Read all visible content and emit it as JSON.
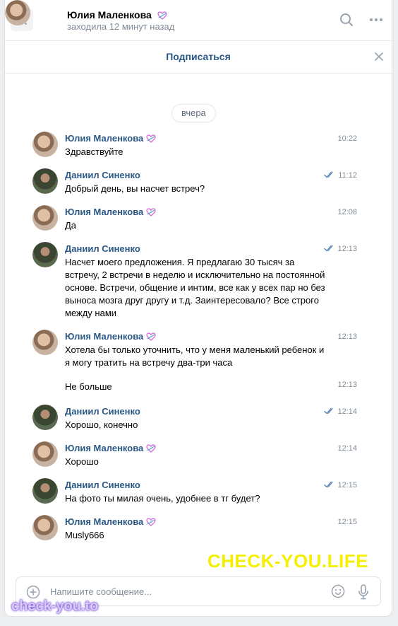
{
  "header": {
    "name": "Юлия Маленкова",
    "status": "заходила 12 минут назад"
  },
  "subscribe": {
    "label": "Подписаться"
  },
  "date_divider": "вчера",
  "messages": [
    {
      "author": "Юлия Маленкова",
      "time": "10:22",
      "text": "Здравствуйте",
      "read": false
    },
    {
      "author": "Даниил Синенко",
      "time": "11:12",
      "text": "Добрый день, вы насчет встреч?",
      "read": true
    },
    {
      "author": "Юлия Маленкова",
      "time": "12:08",
      "text": "Да",
      "read": false
    },
    {
      "author": "Даниил Синенко",
      "time": "12:13",
      "text": "Насчет моего предложения. Я предлагаю 30 тысяч за встречу, 2 встречи в неделю и исключительно на постоянной основе. Встречи, общение и интим, все как у всех пар но без выноса мозга друг другу и т.д. Заинтересовало? Все строго между нами",
      "read": true
    },
    {
      "author": "Юлия Маленкова",
      "time": "12:13",
      "text": "Хотела бы только уточнить, что у меня маленький ребенок и я могу тратить на встречу два-три часа",
      "read": false
    },
    {
      "author": "",
      "time": "12:13",
      "text": "Не больше",
      "read": false
    },
    {
      "author": "Даниил Синенко",
      "time": "12:14",
      "text": "Хорошо, конечно",
      "read": true
    },
    {
      "author": "Юлия Маленкова",
      "time": "12:14",
      "text": "Хорошо",
      "read": false
    },
    {
      "author": "Даниил Синенко",
      "time": "12:15",
      "text": "На фото ты милая очень, удобнее в тг будет?",
      "read": true
    },
    {
      "author": "Юлия Маленкова",
      "time": "12:15",
      "text": "Musly666",
      "read": false
    }
  ],
  "composer": {
    "placeholder": "Напишите сообщение..."
  },
  "watermarks": {
    "big": "CHECK-YOU.LIFE",
    "small": "check-you.to"
  },
  "colors": {
    "link": "#2a5885",
    "muted": "#818c99",
    "read_check": "#5181b8",
    "watermark_big": "#f4f000"
  },
  "icons": [
    "close-icon",
    "search-icon",
    "more-icon",
    "heart-status-icon",
    "read-checks-icon",
    "attach-plus-icon",
    "emoji-icon",
    "microphone-icon"
  ]
}
